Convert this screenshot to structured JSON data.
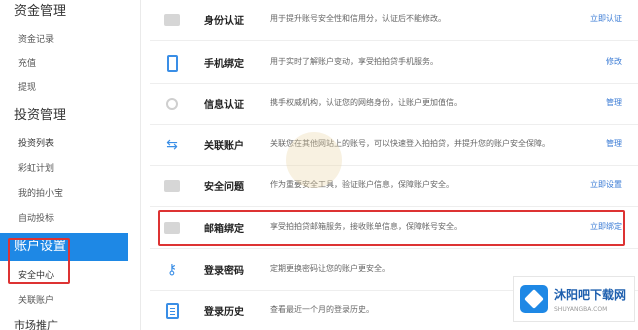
{
  "sidebar": {
    "sections": [
      {
        "title": "资金管理",
        "items": [
          "资金记录",
          "充值",
          "提现"
        ]
      },
      {
        "title": "投资管理",
        "items": [
          "投资列表",
          "彩虹计划",
          "我的拍小宝",
          "自动投标"
        ]
      },
      {
        "title": "账户设置",
        "items": [
          "安全中心",
          "关联账户"
        ]
      },
      {
        "title": "市场推广",
        "items": []
      }
    ]
  },
  "security_rows": [
    {
      "icon": "id-card-icon",
      "label": "身份认证",
      "desc": "用于提升账号安全性和信用分，认证后不能修改。",
      "action": "立即认证"
    },
    {
      "icon": "phone-icon",
      "label": "手机绑定",
      "desc": "用于实时了解账户变动，享受拍拍贷手机服务。",
      "action": "修改"
    },
    {
      "icon": "info-icon",
      "label": "信息认证",
      "desc": "携手权威机构，认证您的网络身份，让账户更加值信。",
      "action": "管理"
    },
    {
      "icon": "link-account-icon",
      "label": "关联账户",
      "desc": "关联您在其他网站上的账号，可以快速登入拍拍贷，并提升您的账户安全保障。",
      "action": "管理"
    },
    {
      "icon": "security-question-icon",
      "label": "安全问题",
      "desc": "作为重要安全工具，验证账户信息，保障账户安全。",
      "action": "立即设置"
    },
    {
      "icon": "email-icon",
      "label": "邮箱绑定",
      "desc": "享受拍拍贷邮箱服务，接收账单信息，保障帐号安全。",
      "action": "立即绑定"
    },
    {
      "icon": "key-icon",
      "label": "登录密码",
      "desc": "定期更换密码让您的账户更安全。",
      "action": ""
    },
    {
      "icon": "history-icon",
      "label": "登录历史",
      "desc": "查看最近一个月的登录历史。",
      "action": ""
    }
  ],
  "logo": {
    "title": "沐阳吧下载网",
    "subtitle": "SHUYANGBA.COM"
  },
  "colors": {
    "accent": "#1e88e5",
    "link": "#3a7bd5",
    "highlight": "#dd3333"
  }
}
